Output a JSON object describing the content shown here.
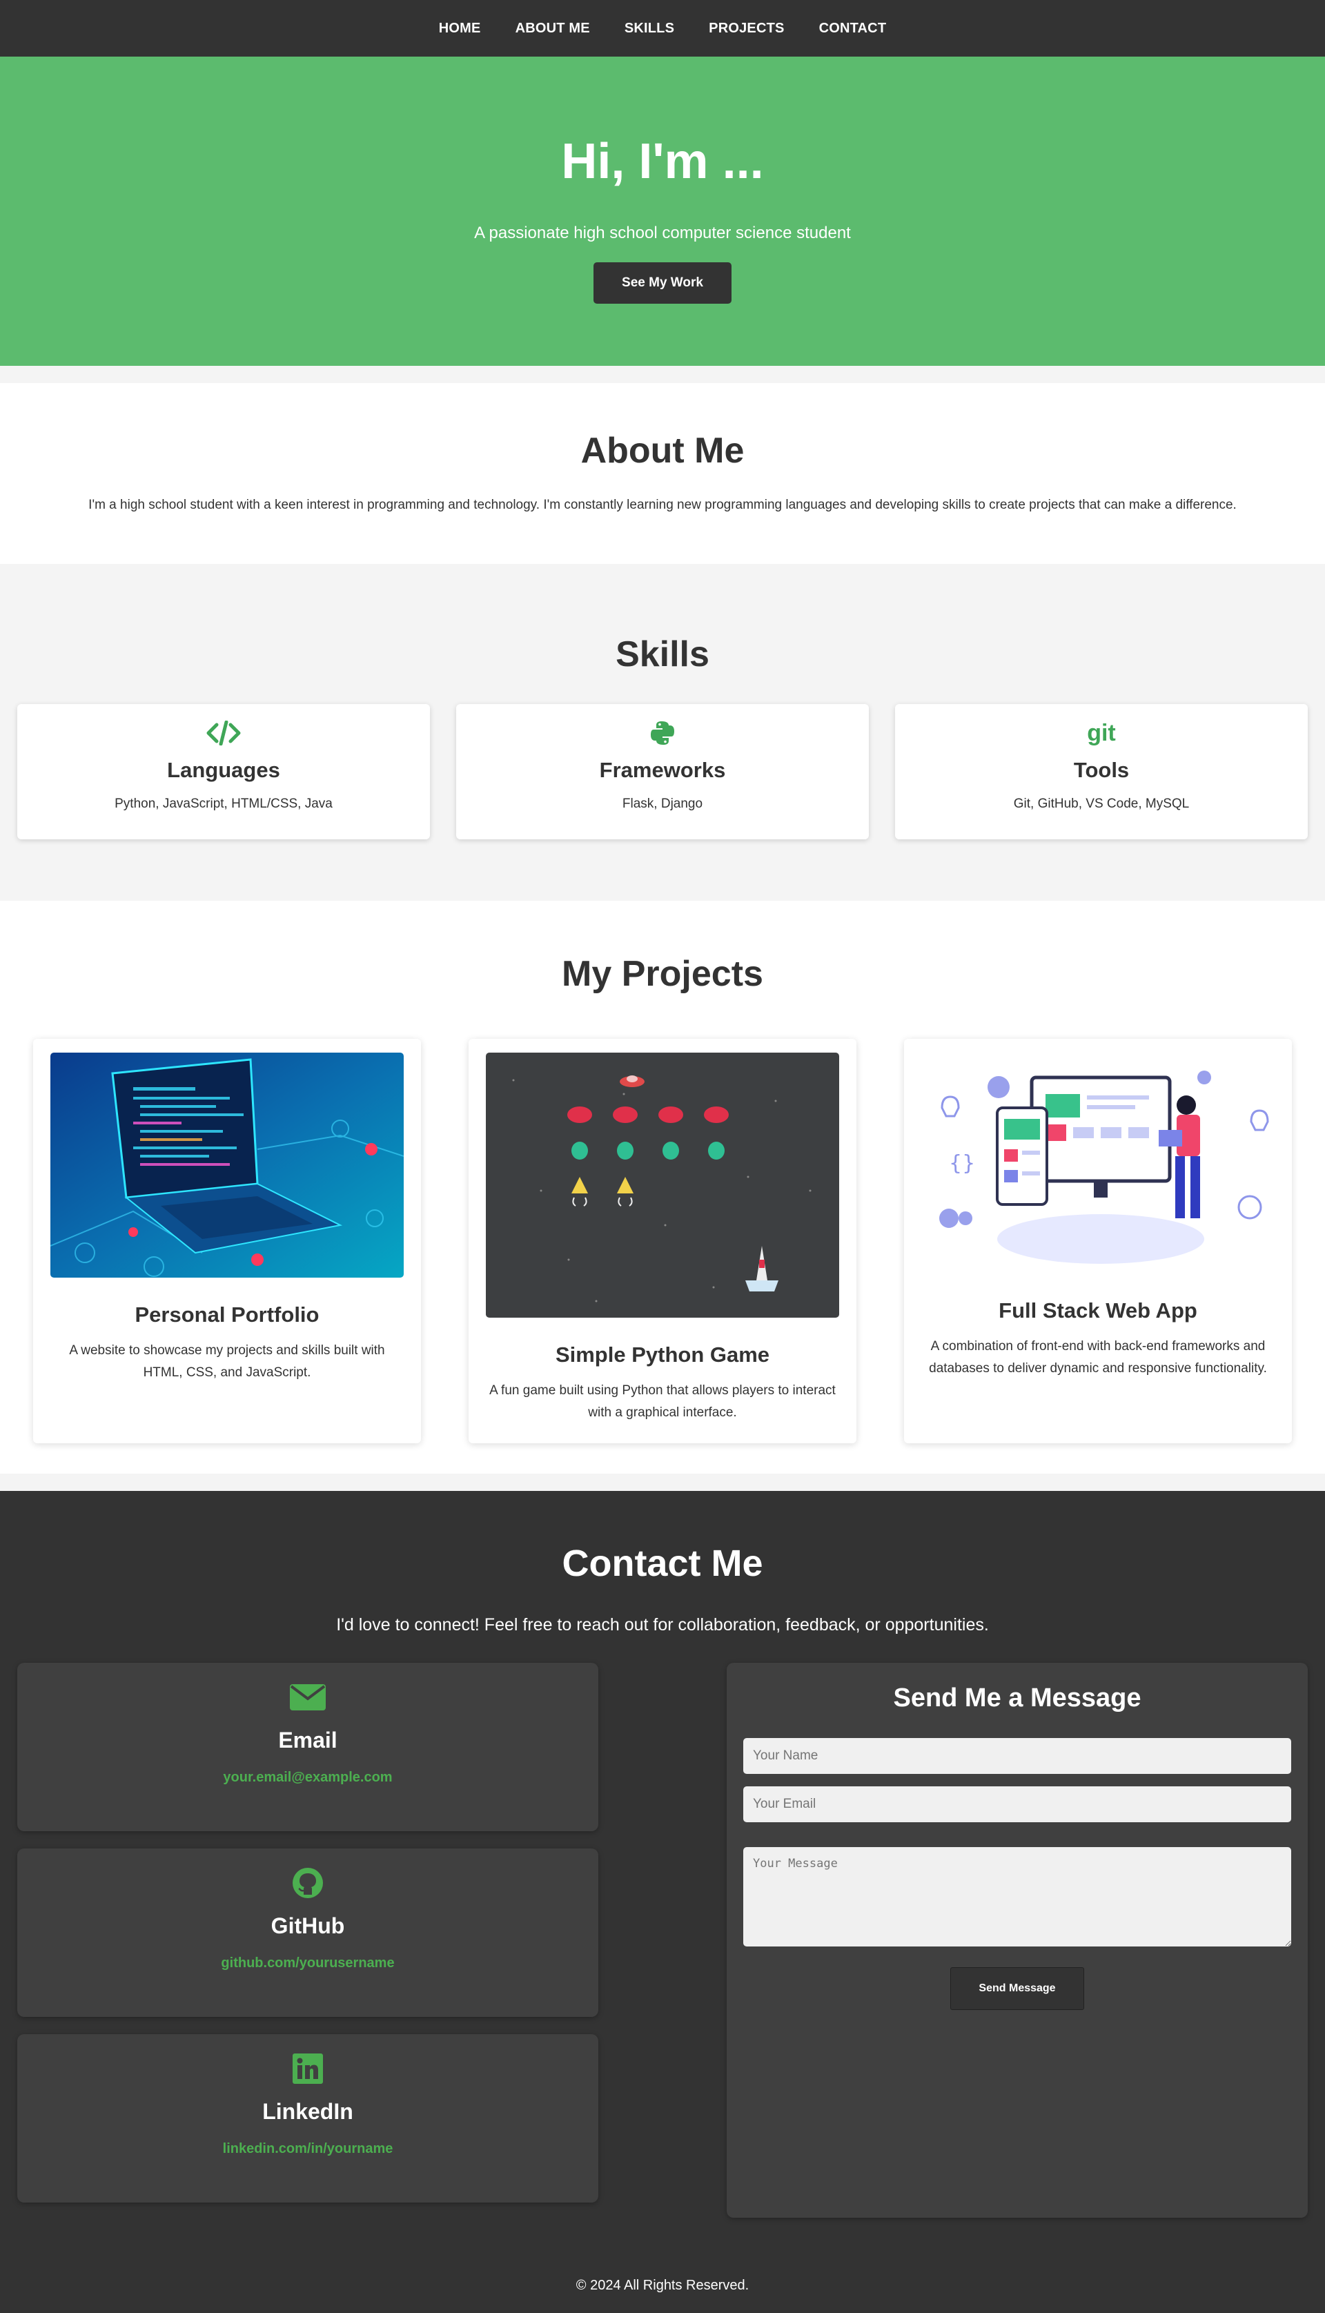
{
  "nav": {
    "items": [
      "HOME",
      "ABOUT ME",
      "SKILLS",
      "PROJECTS",
      "CONTACT"
    ]
  },
  "hero": {
    "title": "Hi, I'm ...",
    "subtitle": "A passionate high school computer science student",
    "button_label": "See My Work",
    "background_color": "#5cbb6e"
  },
  "about": {
    "title": "About Me",
    "text": "I'm a high school student with a keen interest in programming and technology. I'm constantly learning new programming languages and developing skills to create projects that can make a difference."
  },
  "skills": {
    "title": "Skills",
    "items": [
      {
        "icon": "code-icon",
        "title": "Languages",
        "text": "Python, JavaScript, HTML/CSS, Java"
      },
      {
        "icon": "python-icon",
        "title": "Frameworks",
        "text": "Flask, Django"
      },
      {
        "icon": "git-icon",
        "icon_text": "git",
        "title": "Tools",
        "text": "Git, GitHub, VS Code, MySQL"
      }
    ]
  },
  "projects": {
    "title": "My Projects",
    "items": [
      {
        "title": "Personal Portfolio",
        "text": "A website to showcase my projects and skills built with HTML, CSS, and JavaScript."
      },
      {
        "title": "Simple Python Game",
        "text": "A fun game built using Python that allows players to interact with a graphical interface."
      },
      {
        "title": "Full Stack Web App",
        "text": "A combination of front-end with back-end frameworks and databases to deliver dynamic and responsive functionality."
      }
    ]
  },
  "contact": {
    "title": "Contact Me",
    "intro": "I'd love to connect! Feel free to reach out for collaboration, feedback, or opportunities.",
    "cards": [
      {
        "icon": "envelope-icon",
        "title": "Email",
        "link": "your.email@example.com"
      },
      {
        "icon": "github-icon",
        "title": "GitHub",
        "link": "github.com/yourusername"
      },
      {
        "icon": "linkedin-icon",
        "title": "LinkedIn",
        "link": "linkedin.com/in/yourname"
      }
    ],
    "form": {
      "title": "Send Me a Message",
      "name_placeholder": "Your Name",
      "email_placeholder": "Your Email",
      "message_placeholder": "Your Message",
      "button_label": "Send Message"
    },
    "accent_color": "#4caf50"
  },
  "footer": {
    "text": "© 2024 All Rights Reserved."
  }
}
